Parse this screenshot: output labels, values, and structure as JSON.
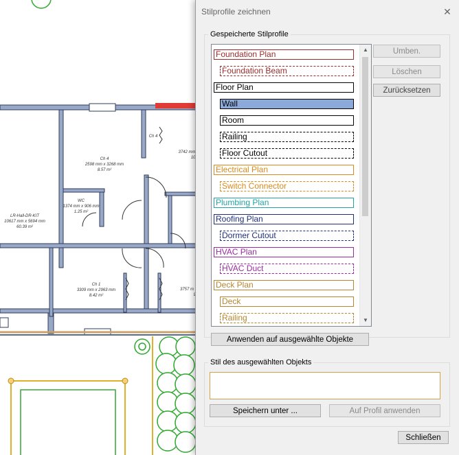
{
  "dialog": {
    "title": "Stilprofile zeichnen",
    "close_glyph": "✕",
    "saved_group_label": "Gespeicherte Stilprofile",
    "selected_group_label": "Stil des ausgewählten Objekts",
    "selected_style_value": ""
  },
  "profiles": [
    {
      "label": "Foundation Plan",
      "color": "#9b2a2a",
      "dashed": false,
      "selected": false,
      "indent": false
    },
    {
      "label": "Foundation Beam",
      "color": "#9b2a2a",
      "dashed": true,
      "selected": false,
      "indent": true
    },
    {
      "label": "Floor Plan",
      "color": "#000000",
      "dashed": false,
      "selected": false,
      "indent": false
    },
    {
      "label": "Wall",
      "color": "#000000",
      "dashed": false,
      "selected": true,
      "indent": true
    },
    {
      "label": "Room",
      "color": "#000000",
      "dashed": false,
      "selected": false,
      "indent": true
    },
    {
      "label": "Railing",
      "color": "#000000",
      "dashed": true,
      "selected": false,
      "indent": true
    },
    {
      "label": "Floor Cutout",
      "color": "#000000",
      "dashed": true,
      "selected": false,
      "indent": true
    },
    {
      "label": "Electrical Plan",
      "color": "#d98a1a",
      "dashed": false,
      "selected": false,
      "indent": false
    },
    {
      "label": "Switch Connector",
      "color": "#d98a1a",
      "dashed": true,
      "selected": false,
      "indent": true
    },
    {
      "label": "Plumbing Plan",
      "color": "#1fa3a6",
      "dashed": false,
      "selected": false,
      "indent": false
    },
    {
      "label": "Roofing Plan",
      "color": "#1f2f7a",
      "dashed": false,
      "selected": false,
      "indent": false
    },
    {
      "label": "Dormer Cutout",
      "color": "#1f2f7a",
      "dashed": true,
      "selected": false,
      "indent": true
    },
    {
      "label": "HVAC Plan",
      "color": "#9a2aa0",
      "dashed": false,
      "selected": false,
      "indent": false
    },
    {
      "label": "HVAC Duct",
      "color": "#9a2aa0",
      "dashed": true,
      "selected": false,
      "indent": true
    },
    {
      "label": "Deck Plan",
      "color": "#b5862e",
      "dashed": false,
      "selected": false,
      "indent": false
    },
    {
      "label": "Deck",
      "color": "#b5862e",
      "dashed": false,
      "selected": false,
      "indent": true
    },
    {
      "label": "Railing",
      "color": "#b5862e",
      "dashed": true,
      "selected": false,
      "indent": true
    }
  ],
  "buttons": {
    "rename": "Umben.",
    "delete": "Löschen",
    "reset": "Zurücksetzen",
    "apply_selected": "Anwenden auf ausgewählte Objekte",
    "save_as": "Speichern unter ...",
    "apply_profile": "Auf Profil anwenden",
    "close": "Schließen"
  },
  "floorplan": {
    "room_ch4": [
      "Ch 4",
      "2598 mm x 3268 mm",
      "8.57 m²"
    ],
    "room_ch4_small": "Ch 4",
    "room_3742": [
      "3742 mm",
      "10."
    ],
    "room_wc": [
      "WC",
      "1374 mm x 906 mm",
      "1.25 m²"
    ],
    "room_lr": [
      "LR-Hall-DR-KIT",
      "10617 mm x 5694 mm",
      "60.39 m²"
    ],
    "room_ch1": [
      "Ch 1",
      "3309 mm x 2963 mm",
      "8.42 m²"
    ],
    "room_3757": [
      "3757 m",
      "9."
    ]
  }
}
